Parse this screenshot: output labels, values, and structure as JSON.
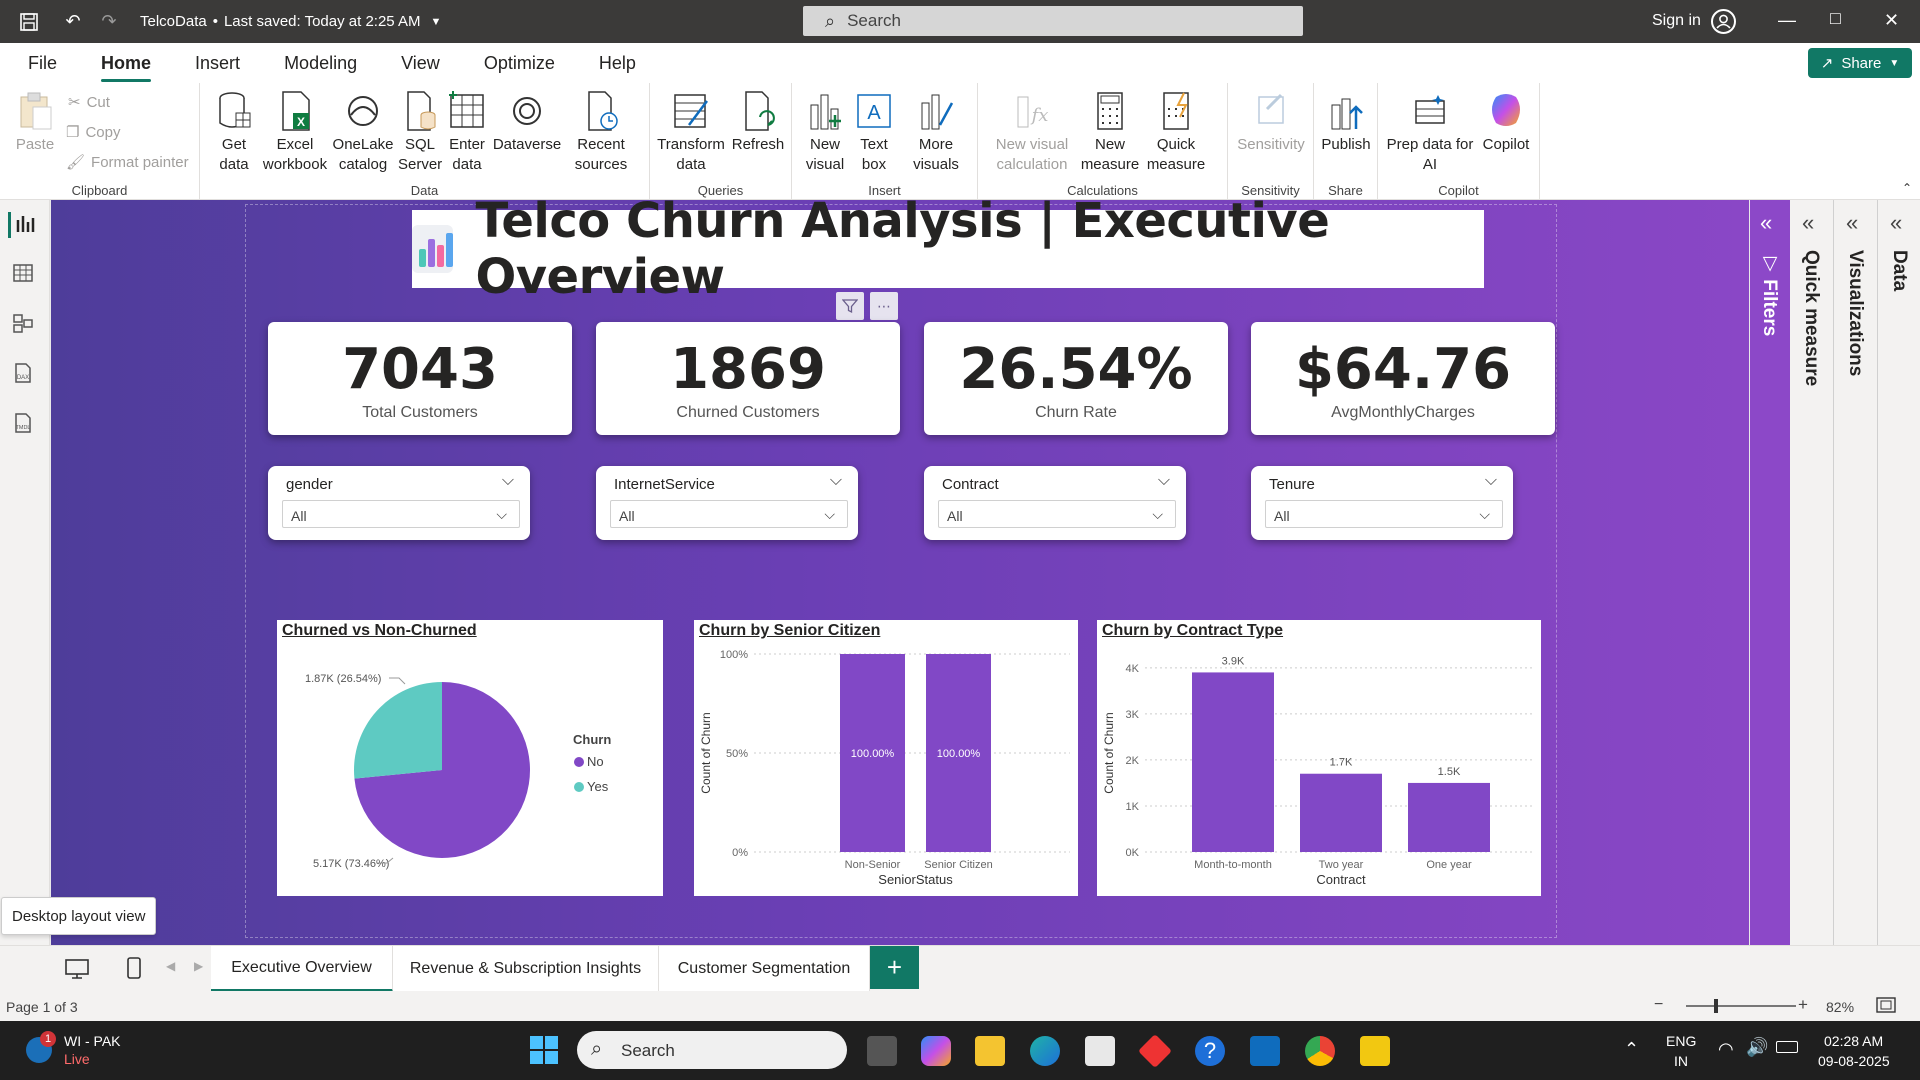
{
  "titlebar": {
    "filename": "TelcoData",
    "saved": "Last saved: Today at 2:25 AM",
    "search_placeholder": "Search",
    "signin": "Sign in"
  },
  "menu": {
    "tabs": [
      "File",
      "Home",
      "Insert",
      "Modeling",
      "View",
      "Optimize",
      "Help"
    ],
    "active": "Home",
    "share_label": "Share"
  },
  "ribbon": {
    "clipboard": {
      "paste": "Paste",
      "cut": "Cut",
      "copy": "Copy",
      "format_painter": "Format painter",
      "group": "Clipboard"
    },
    "data": {
      "get_data": "Get data",
      "excel": "Excel workbook",
      "onelake": "OneLake catalog",
      "sql": "SQL Server",
      "enter": "Enter data",
      "dataverse": "Dataverse",
      "recent": "Recent sources",
      "group": "Data"
    },
    "queries": {
      "transform": "Transform data",
      "refresh": "Refresh",
      "group": "Queries"
    },
    "insert": {
      "new_visual": "New visual",
      "text_box": "Text box",
      "more_visuals": "More visuals",
      "group": "Insert"
    },
    "calculations": {
      "new_visual_calc": "New visual calculation",
      "new_measure": "New measure",
      "quick_measure": "Quick measure",
      "group": "Calculations"
    },
    "sensitivity": {
      "label": "Sensitivity",
      "group": "Sensitivity"
    },
    "share": {
      "publish": "Publish",
      "group": "Share"
    },
    "copilot": {
      "prep": "Prep data for AI",
      "copilot": "Copilot",
      "group": "Copilot"
    }
  },
  "report": {
    "title": "Telco Churn Analysis | Executive Overview",
    "kpis": [
      {
        "value": "7043",
        "label": "Total Customers"
      },
      {
        "value": "1869",
        "label": "Churned Customers"
      },
      {
        "value": "26.54%",
        "label": "Churn Rate"
      },
      {
        "value": "$64.76",
        "label": "AvgMonthlyCharges"
      }
    ],
    "slicers": [
      {
        "title": "gender",
        "value": "All"
      },
      {
        "title": "InternetService",
        "value": "All"
      },
      {
        "title": "Contract",
        "value": "All"
      },
      {
        "title": "Tenure",
        "value": "All"
      }
    ]
  },
  "chart_data": [
    {
      "type": "pie",
      "title": "Churned vs Non-Churned",
      "legend_title": "Churn",
      "legend_position": "right",
      "slices": [
        {
          "name": "No",
          "value": 5.17,
          "label": "5.17K (73.46%)",
          "color": "#8148c6"
        },
        {
          "name": "Yes",
          "value": 1.87,
          "label": "1.87K (26.54%)",
          "color": "#5ecac2"
        }
      ]
    },
    {
      "type": "bar",
      "title": "Churn by Senior Citizen",
      "xlabel": "SeniorStatus",
      "ylabel": "Count of Churn",
      "categories": [
        "Non-Senior",
        "Senior Citizen"
      ],
      "values": [
        100,
        100
      ],
      "value_labels": [
        "100.00%",
        "100.00%"
      ],
      "yticks": [
        "0%",
        "50%",
        "100%"
      ],
      "ylim": [
        0,
        100
      ],
      "color": "#8148c6"
    },
    {
      "type": "bar",
      "title": "Churn by Contract Type",
      "xlabel": "Contract",
      "ylabel": "Count of Churn",
      "categories": [
        "Month-to-month",
        "Two year",
        "One year"
      ],
      "values": [
        3.9,
        1.7,
        1.5
      ],
      "value_labels": [
        "3.9K",
        "1.7K",
        "1.5K"
      ],
      "yticks": [
        "0K",
        "1K",
        "2K",
        "3K",
        "4K"
      ],
      "ylim": [
        0,
        4.3
      ],
      "color": "#8148c6"
    }
  ],
  "right_panes": [
    "Filters",
    "Quick measure",
    "Visualizations",
    "Data"
  ],
  "pages": {
    "tabs": [
      "Executive Overview",
      "Revenue & Subscription Insights",
      "Customer Segmentation"
    ],
    "active": "Executive Overview",
    "tooltip": "Desktop layout view"
  },
  "status": {
    "page": "Page 1 of 3",
    "zoom": "82%"
  },
  "taskbar": {
    "weather_title": "WI - PAK",
    "weather_sub": "Live",
    "badge": "1",
    "search": "Search",
    "lang1": "ENG",
    "lang2": "IN",
    "time": "02:28 AM",
    "date": "09-08-2025"
  }
}
